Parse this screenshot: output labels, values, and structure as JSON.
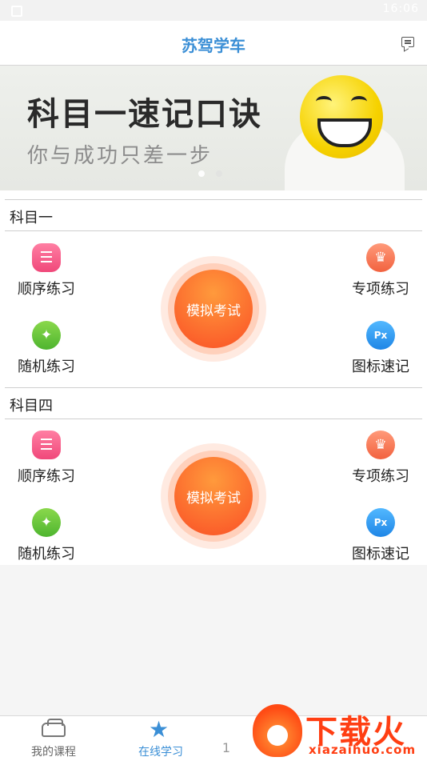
{
  "status_bar": {
    "time": "16:06"
  },
  "header": {
    "title": "苏驾学车"
  },
  "banner": {
    "headline": "科目一速记口诀",
    "subline": "你与成功只差一步"
  },
  "sections": [
    {
      "title": "科目一",
      "items": {
        "sequential": "顺序练习",
        "random": "随机练习",
        "special": "专项练习",
        "icons": "图标速记"
      },
      "exam_label": "模拟考试"
    },
    {
      "title": "科目四",
      "items": {
        "sequential": "顺序练习",
        "random": "随机练习",
        "special": "专项练习",
        "icons": "图标速记"
      },
      "exam_label": "模拟考试"
    }
  ],
  "tabbar": {
    "tab1": "我的课程",
    "tab2": "在线学习",
    "tab3": "1"
  },
  "watermark": {
    "brand": "下载火",
    "url": "xiazaihuo.com"
  },
  "colors": {
    "accent": "#3b8fd6",
    "exam": "#fb5e2a"
  }
}
